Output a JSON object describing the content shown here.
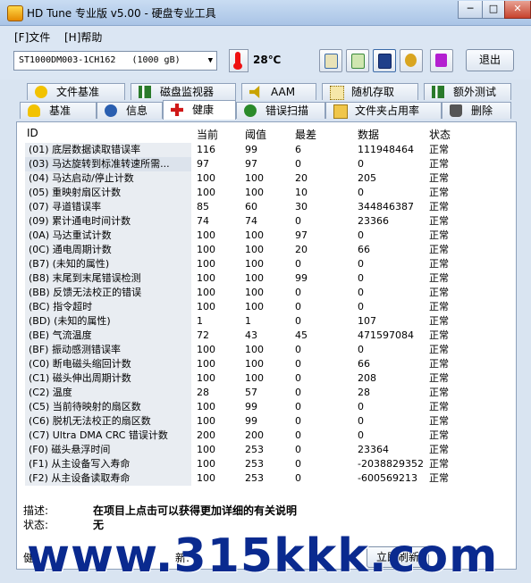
{
  "window": {
    "title": "HD Tune 专业版 v5.00 - 硬盘专业工具",
    "min": "─",
    "max": "□",
    "close": "✕"
  },
  "menu": [
    {
      "label": "[F]文件"
    },
    {
      "label": "[H]帮助"
    }
  ],
  "toolbar": {
    "drive": "ST1000DM003-1CH162",
    "drive_size": "(1000 gB)",
    "temperature": "28℃",
    "buttons": [
      "copy-text-icon",
      "copy-screen-icon",
      "save-icon",
      "options-icon",
      "download-icon"
    ],
    "exit_label": "退出"
  },
  "tabs_row1": [
    {
      "label": "文件基准",
      "icon": "file-benchmark-icon"
    },
    {
      "label": "磁盘监视器",
      "icon": "disk-monitor-icon"
    },
    {
      "label": "AAM",
      "icon": "speaker-icon"
    },
    {
      "label": "随机存取",
      "icon": "random-access-icon"
    },
    {
      "label": "额外测试",
      "icon": "extra-tests-icon"
    }
  ],
  "tabs_row2": [
    {
      "label": "基准",
      "icon": "benchmark-icon"
    },
    {
      "label": "信息",
      "icon": "info-icon"
    },
    {
      "label": "健康",
      "icon": "health-icon"
    },
    {
      "label": "错误扫描",
      "icon": "error-scan-icon"
    },
    {
      "label": "文件夹占用率",
      "icon": "folder-usage-icon"
    },
    {
      "label": "删除",
      "icon": "erase-icon"
    }
  ],
  "active_tab": "健康",
  "columns": {
    "id": "ID",
    "current": "当前",
    "threshold": "阈值",
    "worst": "最差",
    "data": "数据",
    "status": "状态"
  },
  "rows": [
    {
      "id": "(01) 底层数据读取错误率",
      "cur": "116",
      "thr": "99",
      "wor": "6",
      "dat": "111948464",
      "sta": "正常"
    },
    {
      "id": "(03) 马达旋转到标准转速所需...",
      "cur": "97",
      "thr": "97",
      "wor": "0",
      "dat": "0",
      "sta": "正常"
    },
    {
      "id": "(04) 马达启动/停止计数",
      "cur": "100",
      "thr": "100",
      "wor": "20",
      "dat": "205",
      "sta": "正常"
    },
    {
      "id": "(05) 重映射扇区计数",
      "cur": "100",
      "thr": "100",
      "wor": "10",
      "dat": "0",
      "sta": "正常"
    },
    {
      "id": "(07) 寻道错误率",
      "cur": "85",
      "thr": "60",
      "wor": "30",
      "dat": "344846387",
      "sta": "正常"
    },
    {
      "id": "(09) 累计通电时间计数",
      "cur": "74",
      "thr": "74",
      "wor": "0",
      "dat": "23366",
      "sta": "正常"
    },
    {
      "id": "(0A) 马达重试计数",
      "cur": "100",
      "thr": "100",
      "wor": "97",
      "dat": "0",
      "sta": "正常"
    },
    {
      "id": "(0C) 通电周期计数",
      "cur": "100",
      "thr": "100",
      "wor": "20",
      "dat": "66",
      "sta": "正常"
    },
    {
      "id": "(B7) (未知的属性)",
      "cur": "100",
      "thr": "100",
      "wor": "0",
      "dat": "0",
      "sta": "正常"
    },
    {
      "id": "(B8) 末尾到末尾错误检测",
      "cur": "100",
      "thr": "100",
      "wor": "99",
      "dat": "0",
      "sta": "正常"
    },
    {
      "id": "(BB) 反馈无法校正的错误",
      "cur": "100",
      "thr": "100",
      "wor": "0",
      "dat": "0",
      "sta": "正常"
    },
    {
      "id": "(BC) 指令超时",
      "cur": "100",
      "thr": "100",
      "wor": "0",
      "dat": "0",
      "sta": "正常"
    },
    {
      "id": "(BD) (未知的属性)",
      "cur": "1",
      "thr": "1",
      "wor": "0",
      "dat": "107",
      "sta": "正常"
    },
    {
      "id": "(BE) 气流温度",
      "cur": "72",
      "thr": "43",
      "wor": "45",
      "dat": "471597084",
      "sta": "正常"
    },
    {
      "id": "(BF) 振动感测错误率",
      "cur": "100",
      "thr": "100",
      "wor": "0",
      "dat": "0",
      "sta": "正常"
    },
    {
      "id": "(C0) 断电磁头缩回计数",
      "cur": "100",
      "thr": "100",
      "wor": "0",
      "dat": "66",
      "sta": "正常"
    },
    {
      "id": "(C1) 磁头伸出周期计数",
      "cur": "100",
      "thr": "100",
      "wor": "0",
      "dat": "208",
      "sta": "正常"
    },
    {
      "id": "(C2) 温度",
      "cur": "28",
      "thr": "57",
      "wor": "0",
      "dat": "28",
      "sta": "正常"
    },
    {
      "id": "(C5) 当前待映射的扇区数",
      "cur": "100",
      "thr": "99",
      "wor": "0",
      "dat": "0",
      "sta": "正常"
    },
    {
      "id": "(C6) 脱机无法校正的扇区数",
      "cur": "100",
      "thr": "99",
      "wor": "0",
      "dat": "0",
      "sta": "正常"
    },
    {
      "id": "(C7) Ultra DMA CRC 错误计数",
      "cur": "200",
      "thr": "200",
      "wor": "0",
      "dat": "0",
      "sta": "正常"
    },
    {
      "id": "(F0) 磁头悬浮时间",
      "cur": "100",
      "thr": "253",
      "wor": "0",
      "dat": "23364",
      "sta": "正常"
    },
    {
      "id": "(F1) 从主设备写入寿命",
      "cur": "100",
      "thr": "253",
      "wor": "0",
      "dat": "-2038829352",
      "sta": "正常"
    },
    {
      "id": "(F2) 从主设备读取寿命",
      "cur": "100",
      "thr": "253",
      "wor": "0",
      "dat": "-600569213",
      "sta": "正常"
    }
  ],
  "description": {
    "label": "描述:",
    "value": "在项目上点击可以获得更加详细的有关说明"
  },
  "state": {
    "label": "状态:",
    "value": "无"
  },
  "bottom": {
    "left_label": "健",
    "refresh_label": "新:",
    "button": "立即刷新"
  },
  "watermark": "www.315kkk.com"
}
